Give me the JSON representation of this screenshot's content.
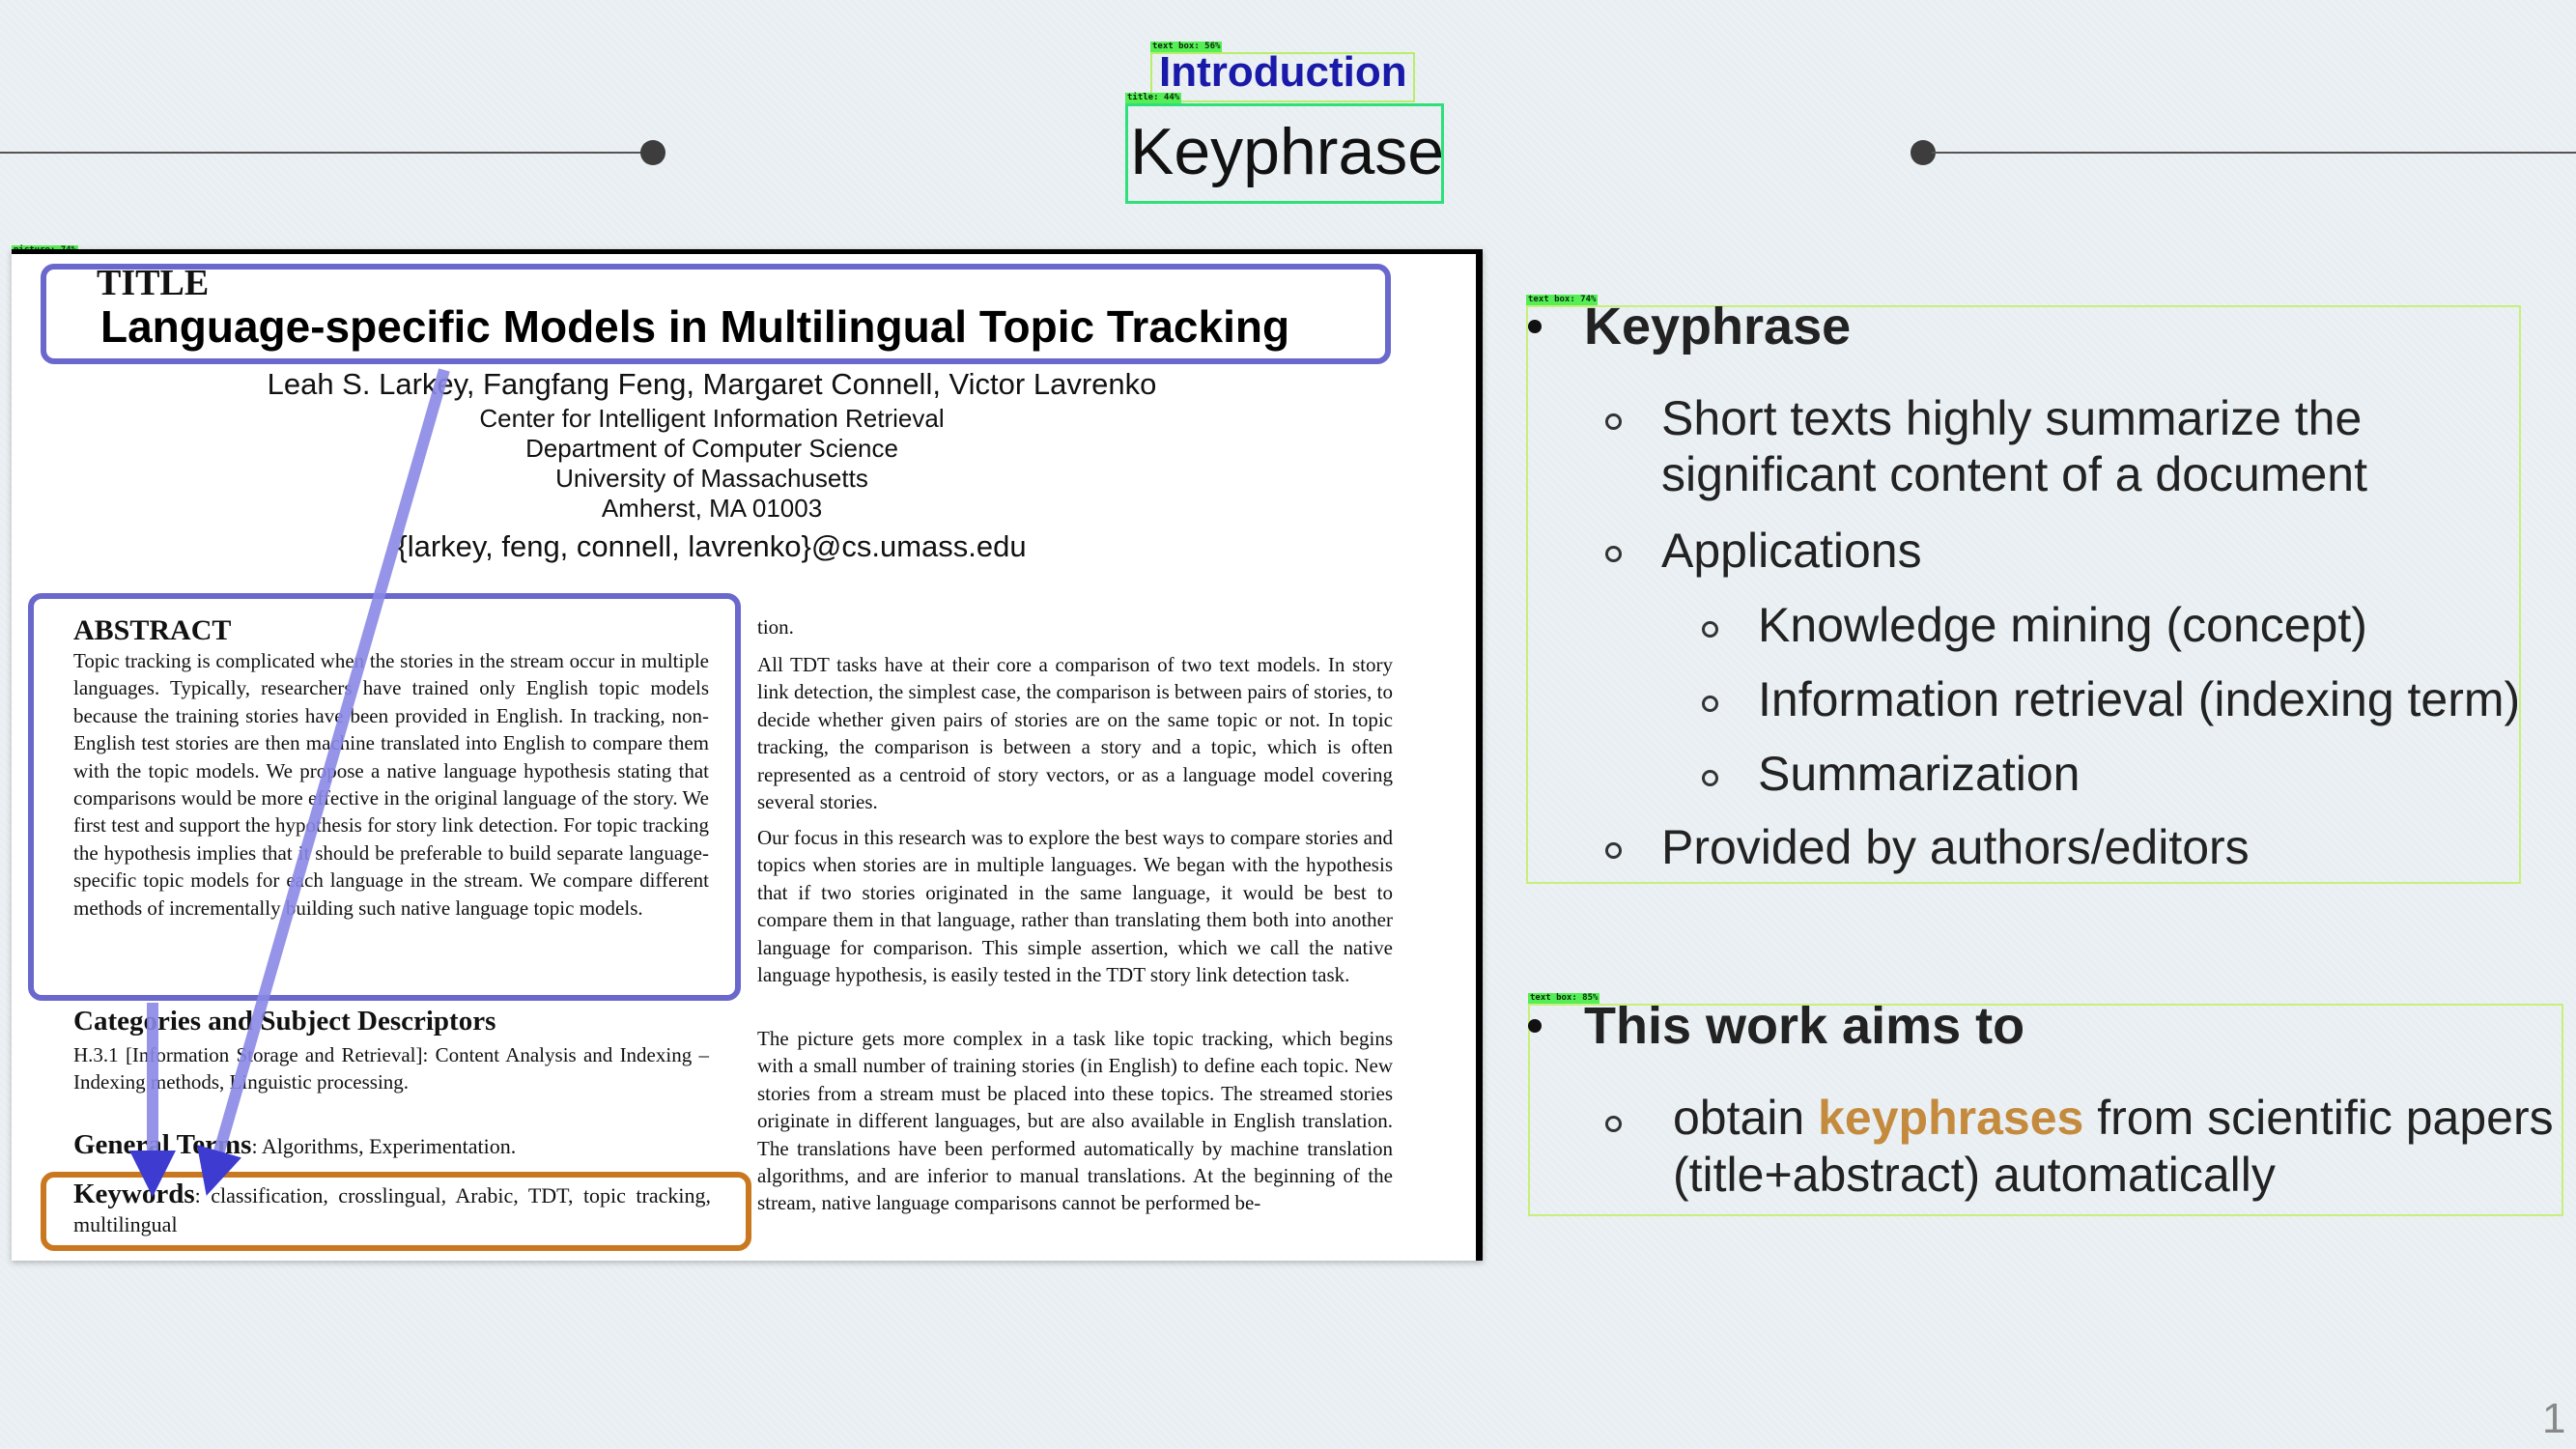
{
  "header": {
    "subtitle": "Introduction",
    "title": "Keyphrase"
  },
  "detections": {
    "subtitle_label": "text box: 56%",
    "title_label": "title: 44%",
    "picture_label": "picture: 74%",
    "right_box1_label": "text box: 74%",
    "right_box2_label": "text box: 85%"
  },
  "paper": {
    "title_tag": "TITLE",
    "title": "Language-specific Models in Multilingual Topic Tracking",
    "authors": "Leah S. Larkey, Fangfang Feng, Margaret Connell, Victor Lavrenko",
    "affiliation": [
      "Center for Intelligent Information Retrieval",
      "Department of Computer Science",
      "University of Massachusetts",
      "Amherst, MA 01003"
    ],
    "email": "{larkey, feng, connell, lavrenko}@cs.umass.edu",
    "abstract_heading": "ABSTRACT",
    "abstract": "Topic tracking is complicated when the stories in the stream occur in multiple languages. Typically, researchers have trained only English topic models because the training stories have been provided in English. In tracking, non-English test stories are then machine translated into English to compare them with the topic models. We propose a native language hypothesis stating that comparisons would be more effective in the original language of the story. We first test and support the hypothesis for story link detection. For topic tracking the hypothesis implies that it should be preferable to build separate language-specific topic models for each language in the stream. We compare different methods of incrementally building such native language topic models.",
    "categories_heading": "Categories and Subject Descriptors",
    "categories_text": "H.3.1 [Information Storage and Retrieval]: Content Analysis and Indexing – Indexing methods, Linguistic processing.",
    "general_heading": "General Terms",
    "general_text": ": Algorithms, Experimentation.",
    "keywords_heading": "Keywords",
    "keywords_text": ": classification, crosslingual, Arabic, TDT, topic tracking, multilingual",
    "right_col": [
      "tion.",
      "All TDT tasks have at their core a comparison of two text models. In story link detection, the simplest case, the comparison is between pairs of stories, to decide whether given pairs of stories are on the same topic or not. In topic tracking, the comparison is between a story and a topic, which is often represented as a centroid of story vectors, or as a language model covering several stories.",
      "Our focus in this research was to explore the best ways to compare stories and topics when stories are in multiple languages. We began with the hypothesis that if two stories originated in the same language, it would be best to compare them in that language, rather than translating them both into another language for comparison. This simple assertion, which we call the native language hypothesis, is easily tested in the TDT story link detection task.",
      "The picture gets more complex in a task like topic tracking, which begins with a small number of training stories (in English) to define each topic. New stories from a stream must be placed into these topics. The streamed stories originate in different languages, but are also available in English translation. The translations have been performed automatically by machine translation algorithms, and are inferior to manual translations. At the beginning of the stream, native language comparisons cannot be performed be-"
    ]
  },
  "right_panel": {
    "section1": {
      "heading": "Keyphrase",
      "items": [
        "Short texts highly summarize the",
        "significant content of a document",
        "Applications",
        "Knowledge mining (concept)",
        "Information retrieval (indexing term)",
        "Summarization",
        "Provided by authors/editors"
      ]
    },
    "section2": {
      "heading": "This work aims to",
      "line1_pre": "obtain ",
      "line1_highlight": "keyphrases",
      "line1_post": " from scientific papers",
      "line2": "(title+abstract) automatically"
    }
  },
  "page_number": "1",
  "colors": {
    "accent_blue": "#6a68cc",
    "accent_orange": "#c9781f",
    "highlight": "#c48a3e",
    "detection_green": "#55ee55"
  }
}
